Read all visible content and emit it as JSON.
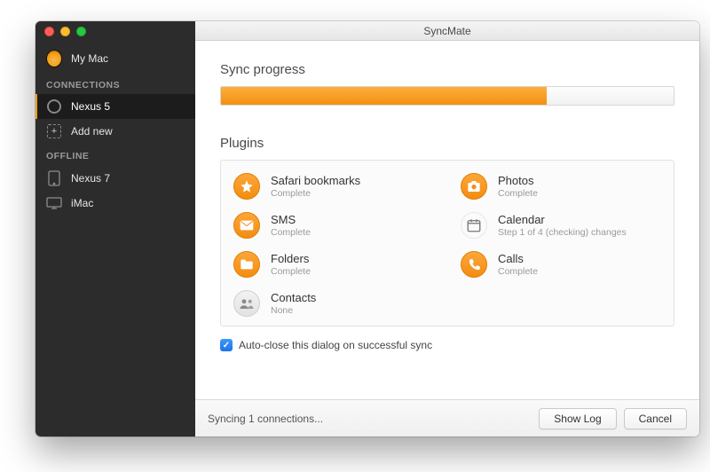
{
  "window": {
    "title": "SyncMate"
  },
  "sidebar": {
    "mymac": "My Mac",
    "headers": {
      "connections": "CONNECTIONS",
      "offline": "OFFLINE"
    },
    "connections": [
      {
        "label": "Nexus 5"
      }
    ],
    "addnew": "Add new",
    "offline": [
      {
        "label": "Nexus 7"
      },
      {
        "label": "iMac"
      }
    ]
  },
  "main": {
    "progress": {
      "title": "Sync progress",
      "percent": 72
    },
    "plugins": {
      "title": "Plugins",
      "items": [
        {
          "name": "Safari bookmarks",
          "status": "Complete",
          "icon": "star",
          "state": "orange"
        },
        {
          "name": "Photos",
          "status": "Complete",
          "icon": "camera",
          "state": "orange"
        },
        {
          "name": "SMS",
          "status": "Complete",
          "icon": "mail",
          "state": "orange"
        },
        {
          "name": "Calendar",
          "status": "Step 1 of 4 (checking) changes",
          "icon": "calendar",
          "state": "none"
        },
        {
          "name": "Folders",
          "status": "Complete",
          "icon": "folder",
          "state": "orange"
        },
        {
          "name": "Calls",
          "status": "Complete",
          "icon": "phone",
          "state": "orange"
        },
        {
          "name": "Contacts",
          "status": "None",
          "icon": "contacts",
          "state": "grey"
        }
      ]
    },
    "autoclose": {
      "checked": true,
      "label": "Auto-close this dialog on successful sync"
    }
  },
  "footer": {
    "status": "Syncing 1 connections...",
    "showlog": "Show Log",
    "cancel": "Cancel"
  }
}
